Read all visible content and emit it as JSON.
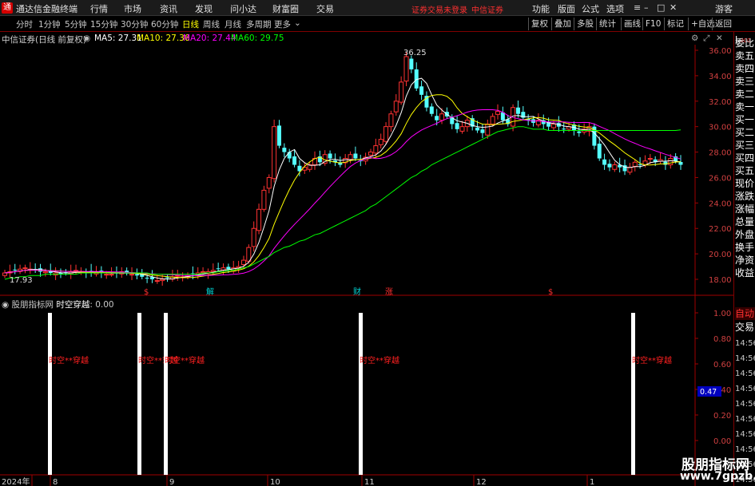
{
  "app": {
    "title": "通达信金融终端",
    "menu": [
      "行情",
      "市场",
      "资讯",
      "发现",
      "问小达",
      "财富圈",
      "交易"
    ],
    "warning": "证券交易未登录",
    "broker": "中信证券",
    "right_menu": [
      "功能",
      "版面",
      "公式",
      "选项"
    ],
    "guest": "游客"
  },
  "toolbar": {
    "periods": [
      "分时",
      "1分钟",
      "5分钟",
      "15分钟",
      "30分钟",
      "60分钟",
      "日线",
      "周线",
      "月线",
      "多周期",
      "更多"
    ],
    "active_period": "日线",
    "tools": [
      "复权",
      "叠加",
      "多股",
      "统计",
      "画线",
      "F10",
      "标记",
      "+自选",
      "返回"
    ]
  },
  "stock": {
    "title": "中信证券(日线 前复权)",
    "ma": [
      {
        "label": "MA5: 27.31",
        "color": "#ffffff"
      },
      {
        "label": "MA10: 27.36",
        "color": "#ffff00"
      },
      {
        "label": "MA20: 27.44",
        "color": "#ff00ff"
      },
      {
        "label": "MA60: 29.75",
        "color": "#00ff00"
      }
    ]
  },
  "right_panel": {
    "top_badge": "L",
    "top_badge_sub": "300",
    "labels": [
      "委比",
      "卖五",
      "卖四",
      "卖三",
      "卖二",
      "卖一",
      "买一",
      "买二",
      "买三",
      "买四",
      "买五",
      "现价",
      "涨跌",
      "涨幅",
      "总量",
      "外盘",
      "换手",
      "净资",
      "收益"
    ],
    "auto_label": "自动",
    "trade_label": "交易",
    "times": [
      "14:56",
      "14:56",
      "14:56",
      "14:56",
      "14:56",
      "14:56",
      "14:56",
      "14:56",
      "14:56",
      "14:56"
    ]
  },
  "chart_data": {
    "type": "candlestick",
    "price_axis": [
      36.0,
      34.0,
      32.0,
      30.0,
      28.0,
      26.0,
      24.0,
      22.0,
      20.0,
      18.0
    ],
    "high_label": "36.25",
    "low_label": "17.93",
    "months": [
      "2024年",
      "8",
      "9",
      "10",
      "11",
      "12",
      "1"
    ],
    "event_markers": [
      {
        "text": "$",
        "color": "#ff3030"
      },
      {
        "text": "解",
        "color": "#00d0d0"
      },
      {
        "text": "财",
        "color": "#00d0d0"
      },
      {
        "text": "涨",
        "color": "#ff3030"
      },
      {
        "text": "$",
        "color": "#ff3030"
      }
    ],
    "ma_colors": {
      "ma5": "#ffffff",
      "ma10": "#ffff00",
      "ma20": "#ff00ff",
      "ma60": "#00ff00"
    },
    "close_series": [
      18.5,
      18.6,
      18.7,
      18.8,
      18.9,
      18.8,
      18.7,
      18.6,
      18.6,
      18.5,
      18.5,
      18.4,
      18.5,
      18.6,
      18.7,
      18.6,
      18.5,
      18.5,
      18.6,
      18.5,
      18.4,
      18.4,
      18.5,
      18.6,
      18.5,
      18.4,
      18.3,
      18.2,
      18.1,
      18.0,
      17.9,
      18.0,
      18.1,
      18.2,
      18.3,
      18.2,
      18.3,
      18.4,
      18.5,
      18.6,
      18.6,
      18.7,
      18.8,
      18.9,
      18.8,
      18.9,
      19.0,
      19.5,
      20.5,
      22.0,
      23.5,
      25.0,
      26.0,
      30.0,
      28.5,
      28.0,
      27.5,
      27.0,
      26.5,
      26.8,
      27.0,
      27.5,
      27.2,
      27.8,
      27.5,
      27.2,
      27.0,
      27.5,
      27.8,
      27.5,
      27.3,
      27.6,
      28.0,
      28.5,
      29.0,
      30.0,
      31.0,
      32.0,
      33.5,
      35.5,
      34.5,
      33.0,
      32.5,
      31.5,
      31.0,
      30.5,
      31.0,
      30.8,
      30.2,
      29.8,
      30.0,
      30.5,
      30.0,
      29.7,
      29.5,
      30.2,
      30.8,
      31.2,
      30.5,
      30.2,
      31.5,
      31.0,
      30.7,
      30.5,
      30.3,
      30.5,
      30.2,
      30.0,
      30.2,
      30.0,
      29.8,
      30.0,
      29.7,
      29.5,
      29.8,
      30.0,
      28.5,
      27.5,
      27.0,
      26.8,
      27.0,
      26.8,
      26.5,
      26.8,
      27.2,
      27.0,
      27.3,
      27.5,
      27.2,
      27.4,
      27.0,
      27.5,
      27.3,
      27.0
    ],
    "ma60_series": [
      18.0,
      18.1,
      18.1,
      18.2,
      18.2,
      18.3,
      18.3,
      18.3,
      18.4,
      18.4,
      18.4,
      18.4,
      18.4,
      18.4,
      18.4,
      18.5,
      18.5,
      18.5,
      18.5,
      18.5,
      18.5,
      18.5,
      18.5,
      18.5,
      18.5,
      18.5,
      18.5,
      18.5,
      18.5,
      18.4,
      18.4,
      18.4,
      18.4,
      18.4,
      18.4,
      18.4,
      18.4,
      18.4,
      18.4,
      18.5,
      18.5,
      18.5,
      18.6,
      18.6,
      18.7,
      18.7,
      18.8,
      18.9,
      19.0,
      19.2,
      19.4,
      19.6,
      19.8,
      20.1,
      20.3,
      20.5,
      20.6,
      20.8,
      21.0,
      21.1,
      21.3,
      21.5,
      21.6,
      21.8,
      22.0,
      22.2,
      22.4,
      22.6,
      22.8,
      23.0,
      23.2,
      23.4,
      23.7,
      23.9,
      24.2,
      24.5,
      24.8,
      25.1,
      25.4,
      25.7,
      26.0,
      26.2,
      26.5,
      26.7,
      27.0,
      27.2,
      27.4,
      27.6,
      27.8,
      28.0,
      28.2,
      28.4,
      28.6,
      28.8,
      29.0,
      29.2,
      29.4,
      29.6,
      29.7,
      29.8,
      29.9,
      30.0,
      30.0,
      29.9,
      29.8,
      29.8,
      29.8,
      29.7,
      29.7,
      29.7,
      29.7,
      29.7,
      29.7,
      29.7,
      29.7,
      29.7,
      29.7,
      29.7,
      29.7,
      29.7,
      29.7,
      29.7,
      29.7,
      29.7,
      29.7,
      29.7,
      29.7,
      29.7,
      29.7,
      29.7,
      29.7,
      29.7,
      29.7,
      29.75
    ],
    "indicator": {
      "title": "股朋指标网",
      "name": "时空穿越",
      "value": "0.00",
      "axis": [
        "1.00",
        "0.80",
        "0.60",
        "0.40",
        "0.20",
        "0.00"
      ],
      "current_value": "0.47",
      "signal_label": "时空**穿越",
      "signals": [
        {
          "bar_index": 12,
          "label": "时空**穿越"
        },
        {
          "bar_index": 38,
          "label": "时空**穿越"
        },
        {
          "bar_index": 46,
          "label": "时空**穿越"
        },
        {
          "bar_index": 101,
          "label": "时空**穿越"
        },
        {
          "bar_index": 177,
          "label": "时空**穿越"
        }
      ]
    }
  },
  "watermark": {
    "line1": "股朋指标网",
    "line2": "www.7gpzb.com"
  }
}
